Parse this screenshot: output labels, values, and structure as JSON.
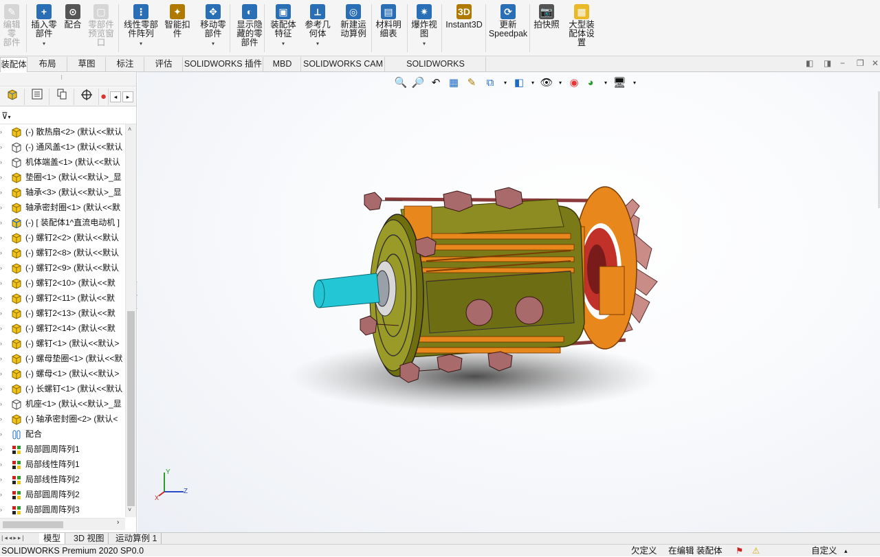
{
  "ribbon": {
    "buttons": [
      {
        "label": "编辑零\n部件",
        "icon": "edit-component-icon",
        "disabled": true
      },
      {
        "label": "插入零\n部件",
        "icon": "insert-component-icon",
        "disabled": false
      },
      {
        "label": "配合",
        "icon": "mate-icon",
        "disabled": false
      },
      {
        "label": "零部件\n预览窗\n口",
        "icon": "component-preview-icon",
        "disabled": true
      },
      {
        "label": "线性零部\n件阵列",
        "icon": "linear-pattern-icon",
        "disabled": false
      },
      {
        "label": "智能扣\n件",
        "icon": "smart-fastener-icon",
        "disabled": false
      },
      {
        "label": "移动零\n部件",
        "icon": "move-component-icon",
        "disabled": false
      },
      {
        "label": "显示隐\n藏的零\n部件",
        "icon": "show-hidden-icon",
        "disabled": false
      },
      {
        "label": "装配体\n特征",
        "icon": "assembly-feature-icon",
        "disabled": false
      },
      {
        "label": "参考几\n何体",
        "icon": "reference-geometry-icon",
        "disabled": false
      },
      {
        "label": "新建运\n动算例",
        "icon": "motion-study-icon",
        "disabled": false
      },
      {
        "label": "材料明\n细表",
        "icon": "bom-icon",
        "disabled": false
      },
      {
        "label": "爆炸视\n图",
        "icon": "exploded-view-icon",
        "disabled": false
      },
      {
        "label": "Instant3D",
        "icon": "instant3d-icon",
        "disabled": false
      },
      {
        "label": "更新\nSpeedpak",
        "icon": "speedpak-icon",
        "disabled": false
      },
      {
        "label": "拍快照",
        "icon": "snapshot-icon",
        "disabled": false
      },
      {
        "label": "大型装\n配体设\n置",
        "icon": "large-assembly-icon",
        "disabled": false
      }
    ]
  },
  "tabs": [
    "装配体",
    "布局",
    "草图",
    "标注",
    "评估",
    "SOLIDWORKS 插件",
    "MBD",
    "SOLIDWORKS CAM",
    "SOLIDWORKS Inspection"
  ],
  "tree": {
    "filter_icon": "filter-icon",
    "items": [
      {
        "label": "(-) 散热扇<2> (默认<<默认",
        "icon": "part"
      },
      {
        "label": "(-) 通风盖<1> (默认<<默认",
        "icon": "part-outline"
      },
      {
        "label": "机体端盖<1> (默认<<默认",
        "icon": "part-outline"
      },
      {
        "label": "垫圈<1> (默认<<默认>_显",
        "icon": "part"
      },
      {
        "label": "轴承<3> (默认<<默认>_显",
        "icon": "part"
      },
      {
        "label": "轴承密封圈<1> (默认<<默",
        "icon": "part"
      },
      {
        "label": "(-) [ 装配体1^直流电动机 ]",
        "icon": "assembly"
      },
      {
        "label": "(-) 螺钉2<2> (默认<<默认",
        "icon": "part"
      },
      {
        "label": "(-) 螺钉2<8> (默认<<默认",
        "icon": "part"
      },
      {
        "label": "(-) 螺钉2<9> (默认<<默认",
        "icon": "part"
      },
      {
        "label": "(-) 螺钉2<10> (默认<<默",
        "icon": "part"
      },
      {
        "label": "(-) 螺钉2<11> (默认<<默",
        "icon": "part"
      },
      {
        "label": "(-) 螺钉2<13> (默认<<默",
        "icon": "part"
      },
      {
        "label": "(-) 螺钉2<14> (默认<<默",
        "icon": "part"
      },
      {
        "label": "(-) 螺钉<1> (默认<<默认>",
        "icon": "part"
      },
      {
        "label": "(-) 螺母垫圈<1> (默认<<默",
        "icon": "part"
      },
      {
        "label": "(-) 螺母<1> (默认<<默认>",
        "icon": "part"
      },
      {
        "label": "(-) 长螺钉<1> (默认<<默认",
        "icon": "part"
      },
      {
        "label": "机座<1> (默认<<默认>_显",
        "icon": "part-outline"
      },
      {
        "label": "(-) 轴承密封圈<2> (默认<",
        "icon": "part"
      },
      {
        "label": "配合",
        "icon": "mates"
      },
      {
        "label": "局部圆周阵列1",
        "icon": "pattern"
      },
      {
        "label": "局部线性阵列1",
        "icon": "pattern"
      },
      {
        "label": "局部线性阵列2",
        "icon": "pattern"
      },
      {
        "label": "局部圆周阵列2",
        "icon": "pattern"
      },
      {
        "label": "局部圆周阵列3",
        "icon": "pattern"
      }
    ]
  },
  "bottom_tabs": [
    "模型",
    "3D 视图",
    "运动算例 1"
  ],
  "status": {
    "app": "SOLIDWORKS Premium 2020 SP0.0",
    "definition": "欠定义",
    "editing": "在编辑 装配体",
    "custom": "自定义"
  },
  "triad": {
    "x_label": "X",
    "y_label": "Y",
    "z_label": "Z"
  },
  "colors": {
    "accent_blue": "#1e6bc7",
    "part_yellow": "#e9b928",
    "motor_olive": "#7a7a18",
    "shaft_cyan": "#22c6d4",
    "flange_orange": "#e8871c"
  }
}
